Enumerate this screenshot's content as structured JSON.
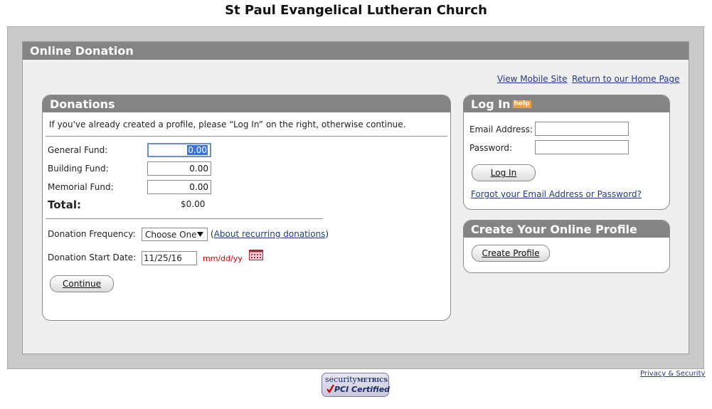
{
  "page": {
    "title": "St Paul Evangelical Lutheran Church"
  },
  "panel": {
    "title": "Online Donation",
    "links": {
      "mobile": "View Mobile Site",
      "home": "Return to our Home Page"
    }
  },
  "donations": {
    "title": "Donations",
    "intro": "If you've already created a profile, please “Log In” on the right, otherwise continue.",
    "funds": [
      {
        "label": "General Fund:",
        "value": "0.00"
      },
      {
        "label": "Building Fund:",
        "value": "0.00"
      },
      {
        "label": "Memorial Fund:",
        "value": "0.00"
      }
    ],
    "total_label": "Total:",
    "total_value": "$0.00",
    "frequency_label": "Donation Frequency:",
    "frequency_selected": "Choose One",
    "frequency_link": "About recurring donations",
    "paren_open": "(",
    "paren_close": ")",
    "start_date_label": "Donation Start Date:",
    "start_date_value": "11/25/16",
    "date_format_hint": "mm/dd/yy",
    "continue_label": "Continue"
  },
  "login": {
    "title": "Log In",
    "help_badge": "help",
    "email_label": "Email Address:",
    "password_label": "Password:",
    "button_label": "Log In",
    "forgot_link": "Forgot your Email Address or Password?"
  },
  "profile": {
    "title": "Create Your Online Profile",
    "button_label": "Create Profile"
  },
  "footer": {
    "privacy_link": "Privacy & Security",
    "badge_line1_a": "security",
    "badge_line1_b": "METRICS",
    "badge_line2": "PCI Certified"
  },
  "colors": {
    "header_gray": "#848484",
    "frame_gray": "#c9c9c9",
    "panel_bg": "#efefef",
    "link_blue": "#1f3a8a",
    "hint_red": "#cc0000",
    "help_orange": "#f29e3d"
  },
  "icons": {
    "calendar": "calendar-icon",
    "dropdown": "chevron-down-icon",
    "check": "check-icon"
  }
}
